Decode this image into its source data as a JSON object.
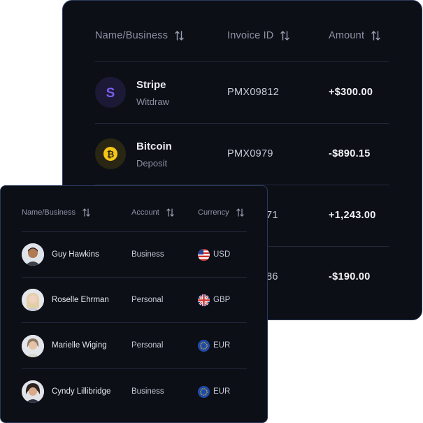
{
  "invoice_table": {
    "headers": {
      "name": "Name/Business",
      "invoice_id": "Invoice ID",
      "amount": "Amount"
    },
    "rows": [
      {
        "name": "Stripe",
        "type": "Witdraw",
        "invoice_id": "PMX09812",
        "amount": "+$300.00",
        "logo_icon": "stripe-logo-icon",
        "logo_color": "#7c5cf0"
      },
      {
        "name": "Bitcoin",
        "type": "Deposit",
        "invoice_id": "PMX0979",
        "amount": "-$890.15",
        "logo_icon": "bitcoin-logo-icon",
        "logo_color": "#f5c518"
      },
      {
        "invoice_id_partial": "71",
        "amount": "+1,243.00"
      },
      {
        "invoice_id_partial": "86",
        "amount": "-$190.00"
      }
    ]
  },
  "accounts_table": {
    "headers": {
      "name": "Name/Business",
      "account": "Account",
      "currency": "Currency"
    },
    "rows": [
      {
        "name": "Guy Hawkins",
        "account": "Business",
        "currency": "USD",
        "flag_icon": "us-flag-icon"
      },
      {
        "name": "Roselle Ehrman",
        "account": "Personal",
        "currency": "GBP",
        "flag_icon": "uk-flag-icon"
      },
      {
        "name": "Marielle Wiging",
        "account": "Personal",
        "currency": "EUR",
        "flag_icon": "eu-flag-icon"
      },
      {
        "name": "Cyndy Lillibridge",
        "account": "Business",
        "currency": "EUR",
        "flag_icon": "eu-flag-icon"
      }
    ]
  },
  "colors": {
    "card_bg": "#0d0f17",
    "card_border": "#2a3a5c",
    "divider": "#22283a",
    "header_text": "#8e94a5"
  }
}
